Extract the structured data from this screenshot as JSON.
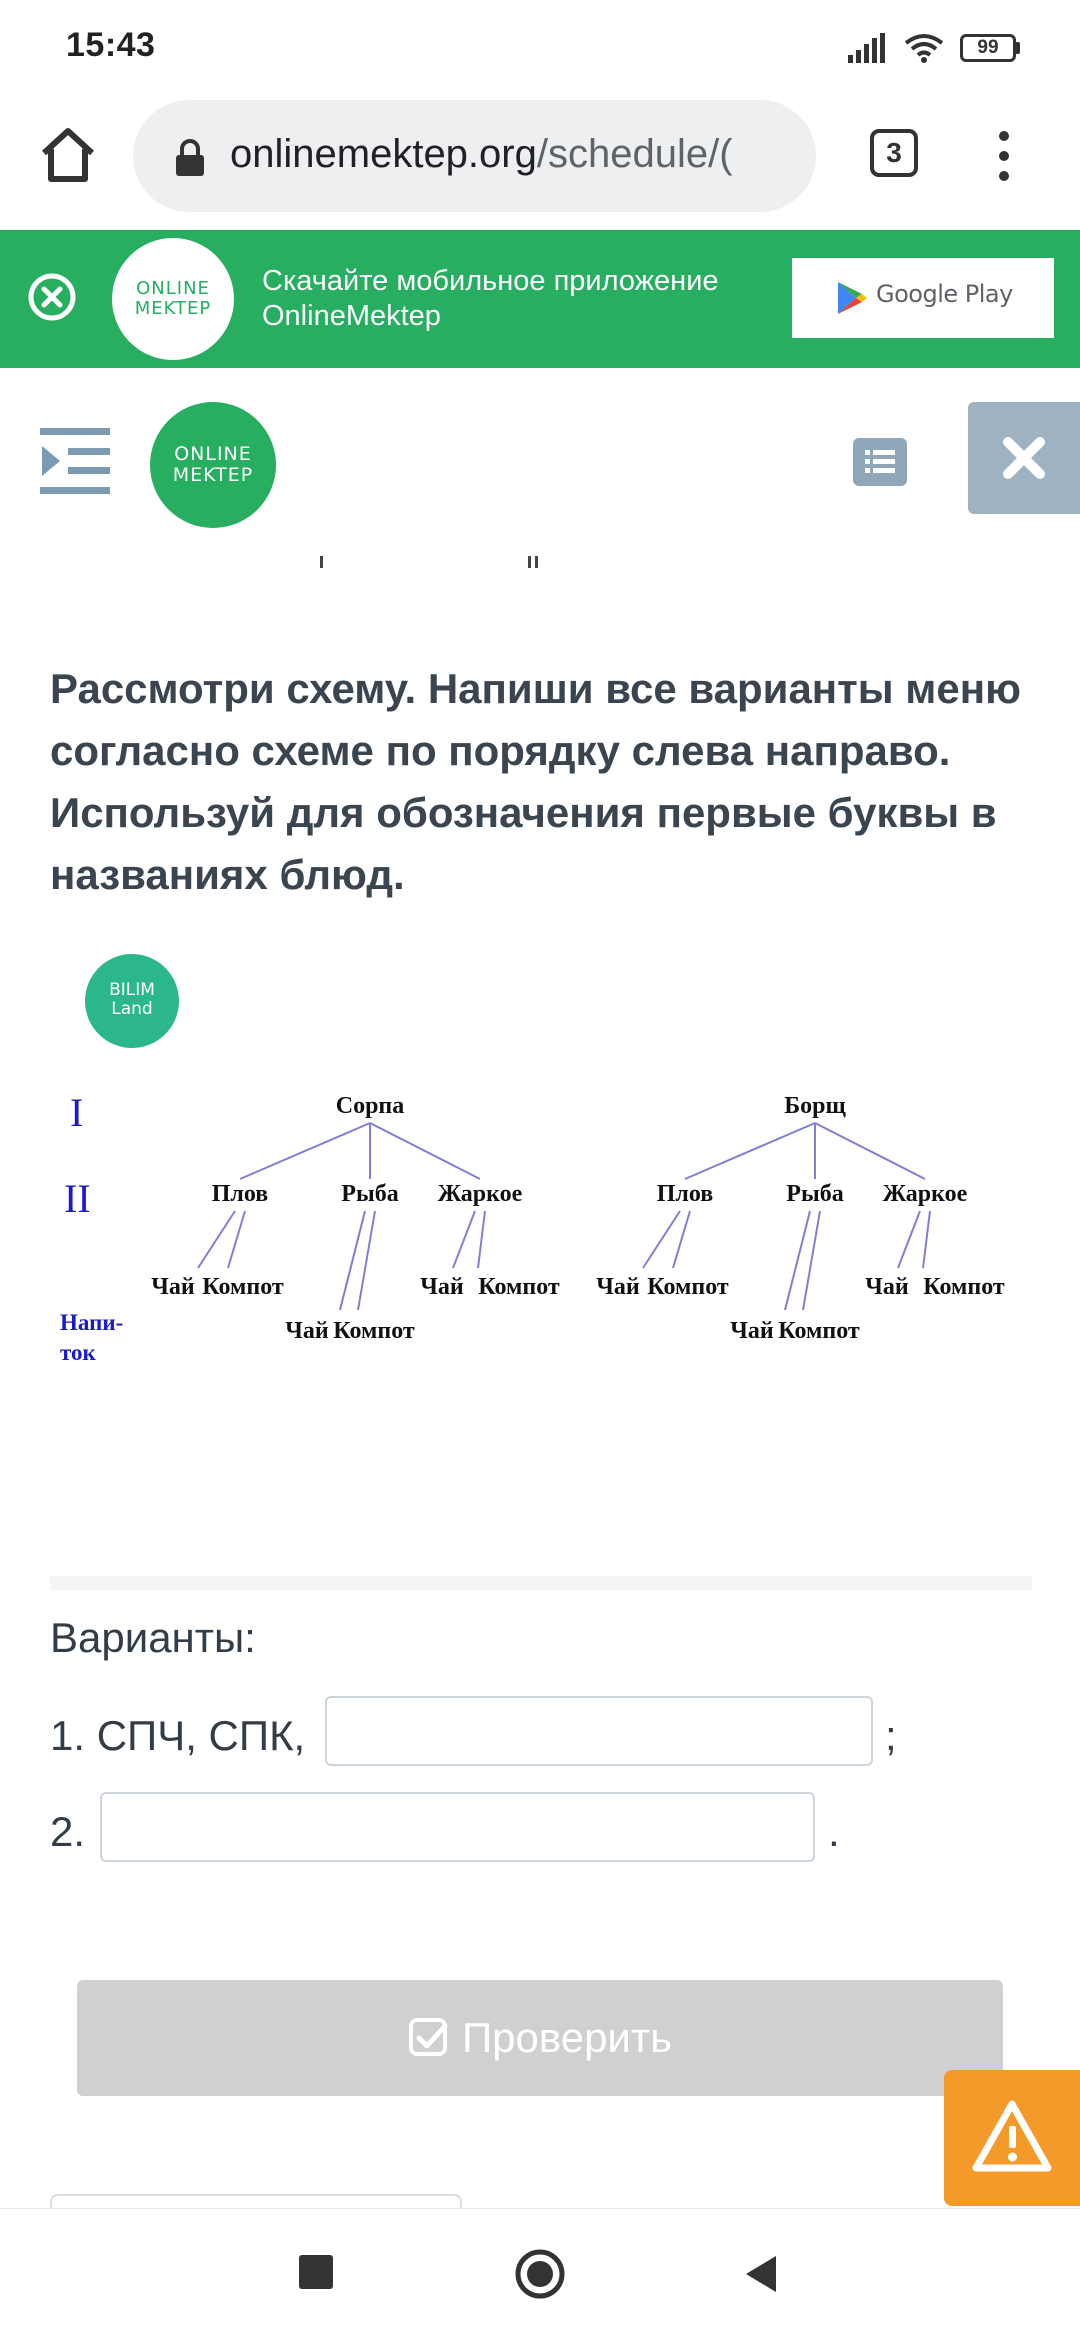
{
  "status_bar": {
    "time": "15:43",
    "battery": "99"
  },
  "browser": {
    "url_host": "onlinemektep.org",
    "url_path": "/schedule/(",
    "tab_count": "3"
  },
  "promo_banner": {
    "logo_line1": "ONLINE",
    "logo_line2": "MEKTEP",
    "text_line1": "Скачайте мобильное приложение",
    "text_line2": "OnlineMektep",
    "store_button": "Google Play"
  },
  "header": {
    "logo_line1": "ONLINE",
    "logo_line2": "MEKTEP"
  },
  "task": {
    "question": "Рассмотри схему. Напиши все варианты меню согласно схеме по порядку слева направо. Используй для обозначения первые буквы в названиях блюд.",
    "badge_line1": "BILIM",
    "badge_line2": "Land",
    "scheme": {
      "level_1": "I",
      "level_2": "II",
      "drink_label_line1": "Напи-",
      "drink_label_line2": "ток",
      "trees": [
        {
          "root": "Сорпа",
          "children": [
            {
              "name": "Плов",
              "leaves": [
                "Чай",
                "Компот"
              ]
            },
            {
              "name": "Рыба",
              "leaves": [
                "Чай",
                "Компот"
              ]
            },
            {
              "name": "Жаркое",
              "leaves": [
                "Чай",
                "Компот"
              ]
            }
          ]
        },
        {
          "root": "Борщ",
          "children": [
            {
              "name": "Плов",
              "leaves": [
                "Чай",
                "Компот"
              ]
            },
            {
              "name": "Рыба",
              "leaves": [
                "Чай",
                "Компот"
              ]
            },
            {
              "name": "Жаркое",
              "leaves": [
                "Чай",
                "Компот"
              ]
            }
          ]
        }
      ]
    }
  },
  "answers": {
    "title": "Варианты:",
    "row1_label": "1. СПЧ, СПК,",
    "row1_value": "",
    "row1_end": ";",
    "row2_label": "2.",
    "row2_value": "",
    "row2_end": "."
  },
  "check_button": "Проверить",
  "colors": {
    "brand_green": "#27ae60",
    "warning_orange": "#f49a2a",
    "scheme_line": "#7f7fd5",
    "scheme_level": "#1a1acc"
  }
}
